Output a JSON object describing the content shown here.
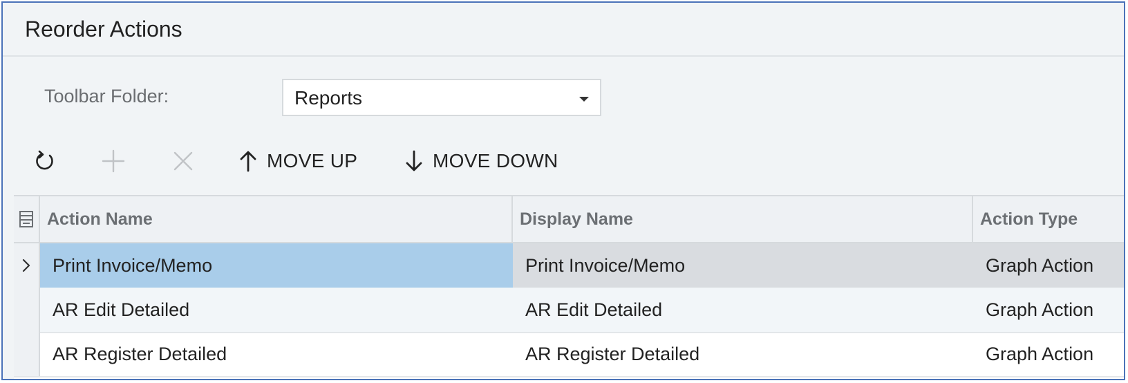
{
  "dialog": {
    "title": "Reorder Actions"
  },
  "form": {
    "toolbar_folder_label": "Toolbar Folder:",
    "toolbar_folder_value": "Reports"
  },
  "toolbar": {
    "refresh_icon": "refresh-icon",
    "add_icon": "plus-icon",
    "delete_icon": "close-icon",
    "move_up_label": "MOVE UP",
    "move_down_label": "MOVE DOWN"
  },
  "grid": {
    "columns": [
      "Action Name",
      "Display Name",
      "Action Type"
    ],
    "rows": [
      {
        "action_name": "Print Invoice/Memo",
        "display_name": "Print Invoice/Memo",
        "action_type": "Graph Action"
      },
      {
        "action_name": "AR Edit Detailed",
        "display_name": "AR Edit Detailed",
        "action_type": "Graph Action"
      },
      {
        "action_name": "AR Register Detailed",
        "display_name": "AR Register Detailed",
        "action_type": "Graph Action"
      }
    ],
    "active_row": 0
  },
  "colors": {
    "border": "#4a72b8",
    "selected_cell": "#a9cdea",
    "background": "#f1f4f6"
  }
}
